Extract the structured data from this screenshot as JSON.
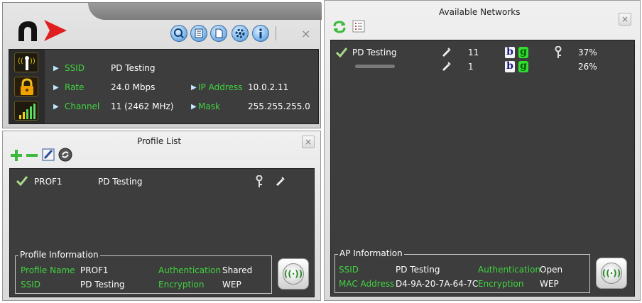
{
  "status": {
    "ssid_label": "SSID",
    "ssid_value": "PD Testing",
    "rate_label": "Rate",
    "rate_value": "24.0 Mbps",
    "channel_label": "Channel",
    "channel_value": "11 (2462 MHz)",
    "ip_label": "IP Address",
    "ip_value": "10.0.2.11",
    "mask_label": "Mask",
    "mask_value": "255.255.255.0",
    "toolbar_icons": [
      "search-icon",
      "list-icon",
      "document-icon",
      "settings-icon",
      "info-icon"
    ],
    "close_glyph": "×"
  },
  "profile_list": {
    "title": "Profile List",
    "close_glyph": "×",
    "profiles": [
      {
        "name": "PROF1",
        "ssid": "PD Testing"
      }
    ],
    "info": {
      "legend": "Profile Information",
      "profile_name_label": "Profile Name",
      "profile_name_value": "PROF1",
      "ssid_label": "SSID",
      "ssid_value": "PD Testing",
      "auth_label": "Authentication",
      "auth_value": "Shared",
      "enc_label": "Encryption",
      "enc_value": "WEP"
    }
  },
  "available_networks": {
    "title": "Available Networks",
    "close_glyph": "×",
    "networks": [
      {
        "ssid": "PD Testing",
        "channel": "11",
        "b": "b",
        "g": "g",
        "signal": "37%",
        "connected": true,
        "secured": true
      },
      {
        "ssid": "",
        "channel": "1",
        "b": "b",
        "g": "g",
        "signal": "26%",
        "connected": false,
        "secured": false
      }
    ],
    "ap_info": {
      "legend": "AP Information",
      "ssid_label": "SSID",
      "ssid_value": "PD Testing",
      "mac_label": "MAC Address",
      "mac_value": "D4-9A-20-7A-64-7C",
      "auth_label": "Authentication",
      "auth_value": "Open",
      "enc_label": "Encryption",
      "enc_value": "WEP"
    }
  },
  "colors": {
    "label_green": "#3fd43f",
    "dark_bg": "#3d3d3d",
    "brand_red": "#e02020"
  }
}
